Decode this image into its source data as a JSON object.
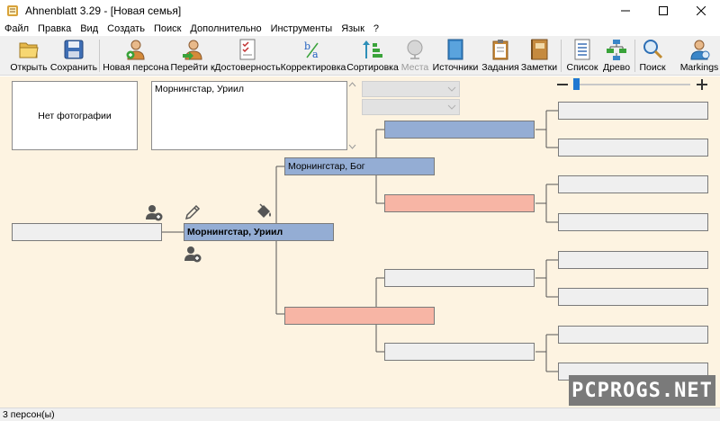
{
  "window": {
    "title": "Ahnenblatt 3.29 - [Новая семья]"
  },
  "menu": [
    "Файл",
    "Правка",
    "Вид",
    "Создать",
    "Поиск",
    "Дополнительно",
    "Инструменты",
    "Язык",
    "?"
  ],
  "toolbar": [
    {
      "label": "Открыть",
      "icon": "open-folder-icon"
    },
    {
      "label": "Сохранить",
      "icon": "save-disk-icon"
    },
    {
      "label": "Новая персона",
      "icon": "new-person-icon"
    },
    {
      "label": "Перейти к",
      "icon": "go-to-person-icon"
    },
    {
      "label": "Достоверность",
      "icon": "checklist-icon"
    },
    {
      "label": "Корректировка",
      "icon": "spelling-correction-icon"
    },
    {
      "label": "Сортировка",
      "icon": "sort-icon"
    },
    {
      "label": "Места",
      "icon": "globe-icon",
      "disabled": true
    },
    {
      "label": "Источники",
      "icon": "book-icon"
    },
    {
      "label": "Задания",
      "icon": "clipboard-icon"
    },
    {
      "label": "Заметки",
      "icon": "notebook-icon"
    },
    {
      "label": "Список",
      "icon": "list-icon"
    },
    {
      "label": "Древо",
      "icon": "family-tree-icon"
    },
    {
      "label": "Поиск",
      "icon": "magnifier-icon"
    },
    {
      "label": "Markings",
      "icon": "markings-person-icon"
    }
  ],
  "info": {
    "photo_placeholder": "Нет фотографии",
    "notes_text": "Морнингстар, Уриил"
  },
  "tree": {
    "root": {
      "name": "Морнингстар, Уриил"
    },
    "father": {
      "name": "Морнингстар, Бог"
    },
    "mother": {
      "name": ""
    },
    "spouse": {
      "name": ""
    },
    "paternal_grandfather": {
      "name": ""
    },
    "paternal_grandmother": {
      "name": ""
    },
    "maternal_grandfather": {
      "name": ""
    },
    "maternal_grandmother": {
      "name": ""
    },
    "great_grandparents": [
      "",
      "",
      "",
      "",
      "",
      "",
      "",
      ""
    ]
  },
  "status": {
    "text": "3 персон(ы)"
  },
  "watermark": "PCPROGS.NET",
  "colors": {
    "male": "#94add4",
    "female": "#f7b5a5",
    "empty": "#efefef",
    "background": "#fdf3e1"
  }
}
